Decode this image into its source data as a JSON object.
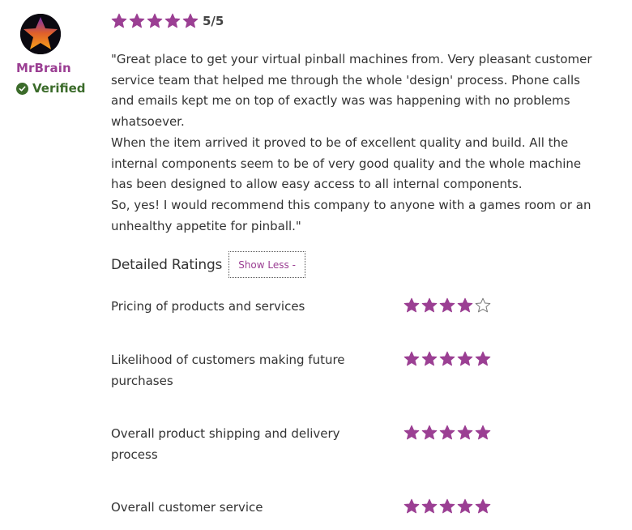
{
  "reviewer": {
    "name": "MrBrain",
    "verified_label": "Verified",
    "avatar_icon": "star-avatar-icon"
  },
  "overall": {
    "rating": 5,
    "max": 5,
    "score_text": "5/5"
  },
  "review": {
    "paragraphs": [
      "\"Great place to get your virtual pinball machines from. Very pleasant customer service team that helped me through the whole 'design' process. Phone calls and emails kept me on top of exactly was was happening with no problems whatsoever.",
      "When the item arrived it proved to be of excellent quality and build. All the internal components seem to be of very good quality and the whole machine has been designed to allow easy access to all internal components.",
      "So, yes! I would recommend this company to anyone with a games room or an unhealthy appetite for pinball.\""
    ]
  },
  "detailed": {
    "title": "Detailed Ratings",
    "toggle_label": "Show Less -",
    "ratings": [
      {
        "label": "Pricing of products and services",
        "value": 4,
        "max": 5
      },
      {
        "label": "Likelihood of customers making future purchases",
        "value": 5,
        "max": 5
      },
      {
        "label": "Overall product shipping and delivery process",
        "value": 5,
        "max": 5
      },
      {
        "label": "Overall customer service",
        "value": 5,
        "max": 5
      }
    ]
  },
  "colors": {
    "accent": "#9b3f93",
    "verified": "#3b6b2a",
    "star_filled": "#9b3f93",
    "star_empty_stroke": "#777777"
  }
}
